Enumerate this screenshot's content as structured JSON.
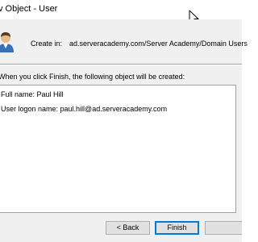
{
  "window": {
    "title": "v Object - User"
  },
  "header": {
    "create_in_label": "Create in:",
    "create_in_value": "ad.serveracademy.com/Server Academy/Domain Users",
    "icon": "user-icon"
  },
  "summary": {
    "intro": "When you click Finish, the following object will be created:",
    "lines": [
      "Full name: Paul Hill",
      "User logon name: paul.hill@ad.serveracademy.com"
    ]
  },
  "buttons": {
    "back_label": "< Back",
    "finish_label": "Finish",
    "cancel_label": ""
  },
  "colors": {
    "dialog_background": "#f0f0f0",
    "title_background": "#ffffff",
    "default_button_border": "#0078d7"
  }
}
